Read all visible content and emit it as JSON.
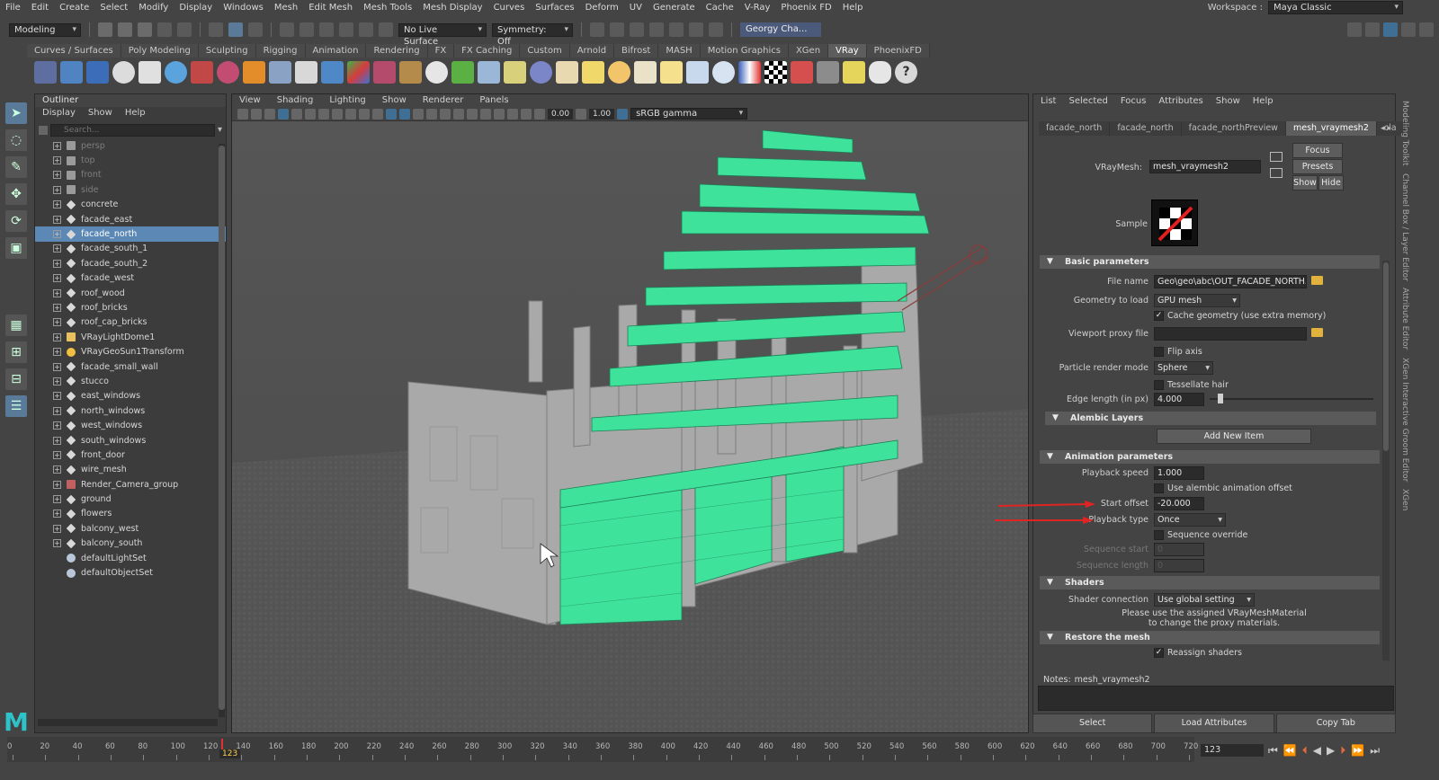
{
  "menubar": {
    "items": [
      "File",
      "Edit",
      "Create",
      "Select",
      "Modify",
      "Display",
      "Windows",
      "Mesh",
      "Edit Mesh",
      "Mesh Tools",
      "Mesh Display",
      "Curves",
      "Surfaces",
      "Deform",
      "UV",
      "Generate",
      "Cache",
      "V-Ray",
      "Phoenix FD",
      "Help"
    ],
    "workspace_label": "Workspace :",
    "workspace_value": "Maya Classic"
  },
  "statusline": {
    "mode": "Modeling",
    "live_surface": "No Live Surface",
    "symmetry": "Symmetry: Off",
    "user": "Georgy Cha..."
  },
  "shelf": {
    "tabs": [
      "Curves / Surfaces",
      "Poly Modeling",
      "Sculpting",
      "Rigging",
      "Animation",
      "Rendering",
      "FX",
      "FX Caching",
      "Custom",
      "Arnold",
      "Bifrost",
      "MASH",
      "Motion Graphics",
      "XGen",
      "VRay",
      "PhoenixFD"
    ],
    "active_tab": "VRay"
  },
  "outliner": {
    "title": "Outliner",
    "menu": [
      "Display",
      "Show",
      "Help"
    ],
    "search_placeholder": "Search...",
    "items": [
      {
        "label": "persp",
        "dim": true,
        "icon": "camera-icon"
      },
      {
        "label": "top",
        "dim": true,
        "icon": "camera-icon"
      },
      {
        "label": "front",
        "dim": true,
        "icon": "camera-icon"
      },
      {
        "label": "side",
        "dim": true,
        "icon": "camera-icon"
      },
      {
        "label": "concrete",
        "dim": false,
        "icon": "transform-icon"
      },
      {
        "label": "facade_east",
        "dim": false,
        "icon": "transform-icon"
      },
      {
        "label": "facade_north",
        "dim": false,
        "icon": "transform-icon",
        "selected": true
      },
      {
        "label": "facade_south_1",
        "dim": false,
        "icon": "transform-icon"
      },
      {
        "label": "facade_south_2",
        "dim": false,
        "icon": "transform-icon"
      },
      {
        "label": "facade_west",
        "dim": false,
        "icon": "transform-icon"
      },
      {
        "label": "roof_wood",
        "dim": false,
        "icon": "transform-icon"
      },
      {
        "label": "roof_bricks",
        "dim": false,
        "icon": "transform-icon"
      },
      {
        "label": "roof_cap_bricks",
        "dim": false,
        "icon": "transform-icon"
      },
      {
        "label": "VRayLightDome1",
        "dim": false,
        "icon": "dome-light-icon"
      },
      {
        "label": "VRayGeoSun1Transform",
        "dim": false,
        "icon": "sun-icon"
      },
      {
        "label": "facade_small_wall",
        "dim": false,
        "icon": "transform-icon"
      },
      {
        "label": "stucco",
        "dim": false,
        "icon": "transform-icon"
      },
      {
        "label": "east_windows",
        "dim": false,
        "icon": "transform-icon"
      },
      {
        "label": "north_windows",
        "dim": false,
        "icon": "transform-icon"
      },
      {
        "label": "west_windows",
        "dim": false,
        "icon": "transform-icon"
      },
      {
        "label": "south_windows",
        "dim": false,
        "icon": "transform-icon"
      },
      {
        "label": "front_door",
        "dim": false,
        "icon": "transform-icon"
      },
      {
        "label": "wire_mesh",
        "dim": false,
        "icon": "transform-icon"
      },
      {
        "label": "Render_Camera_group",
        "dim": false,
        "icon": "camera-group-icon"
      },
      {
        "label": "ground",
        "dim": false,
        "icon": "transform-icon"
      },
      {
        "label": "flowers",
        "dim": false,
        "icon": "transform-icon"
      },
      {
        "label": "balcony_west",
        "dim": false,
        "icon": "transform-icon"
      },
      {
        "label": "balcony_south",
        "dim": false,
        "icon": "transform-icon"
      },
      {
        "label": "defaultLightSet",
        "dim": false,
        "icon": "set-icon"
      },
      {
        "label": "defaultObjectSet",
        "dim": false,
        "icon": "set-icon"
      }
    ]
  },
  "viewport": {
    "menu": [
      "View",
      "Shading",
      "Lighting",
      "Show",
      "Renderer",
      "Panels"
    ],
    "value_a": "0.00",
    "value_b": "1.00",
    "color_space": "sRGB gamma"
  },
  "attribute_editor": {
    "menu": [
      "List",
      "Selected",
      "Focus",
      "Attributes",
      "Show",
      "Help"
    ],
    "tabs": [
      "facade_north",
      "facade_north",
      "facade_northPreview",
      "mesh_vraymesh2",
      "cla"
    ],
    "active_tab": "mesh_vraymesh2",
    "node_label": "VRayMesh:",
    "node_value": "mesh_vraymesh2",
    "buttons": {
      "focus": "Focus",
      "presets": "Presets",
      "show": "Show",
      "hide": "Hide"
    },
    "sample_label": "Sample",
    "sections": {
      "basic": "Basic parameters",
      "alembic": "Alembic Layers",
      "animation": "Animation parameters",
      "shaders": "Shaders",
      "restore": "Restore the mesh"
    },
    "fields": {
      "file_name_label": "File name",
      "file_name_value": "Geo\\geo\\abc\\OUT_FACADE_NORTH.abc",
      "geometry_label": "Geometry to load",
      "geometry_value": "GPU mesh",
      "cache_geometry": "Cache geometry (use extra memory)",
      "viewport_proxy_label": "Viewport proxy file",
      "viewport_proxy_value": "",
      "flip_axis": "Flip axis",
      "particle_label": "Particle render mode",
      "particle_value": "Sphere",
      "tessellate": "Tessellate hair",
      "edge_label": "Edge length (in px)",
      "edge_value": "4.000",
      "add_new_item": "Add New Item",
      "playback_speed_label": "Playback speed",
      "playback_speed_value": "1.000",
      "use_alembic_offset": "Use alembic animation offset",
      "start_offset_label": "Start offset",
      "start_offset_value": "-20.000",
      "playback_type_label": "Playback type",
      "playback_type_value": "Once",
      "sequence_override": "Sequence override",
      "sequence_start_label": "Sequence start",
      "sequence_start_value": "0",
      "sequence_length_label": "Sequence length",
      "sequence_length_value": "0",
      "shader_connection_label": "Shader connection",
      "shader_connection_value": "Use global setting",
      "shader_note_1": "Please use the assigned VRayMeshMaterial",
      "shader_note_2": "to change the proxy materials.",
      "reassign_shaders": "Reassign shaders"
    },
    "notes_label": "Notes:",
    "notes_value": "mesh_vraymesh2",
    "bottom_buttons": [
      "Select",
      "Load Attributes",
      "Copy Tab"
    ]
  },
  "side_tabs": [
    "Modeling Toolkit",
    "Channel Box / Layer Editor",
    "Attribute Editor",
    "XGen Interactive Groom Editor",
    "XGen"
  ],
  "timeline": {
    "ticks": [
      "0",
      "20",
      "40",
      "60",
      "80",
      "100",
      "120",
      "140",
      "160",
      "180",
      "200",
      "220",
      "240",
      "260",
      "280",
      "300",
      "320",
      "340",
      "360",
      "380",
      "400",
      "420",
      "440",
      "460",
      "480",
      "500",
      "520",
      "540",
      "560",
      "580",
      "600",
      "620",
      "640",
      "660",
      "680",
      "700",
      "720"
    ],
    "current_marker": "123",
    "current_frame": "123"
  }
}
